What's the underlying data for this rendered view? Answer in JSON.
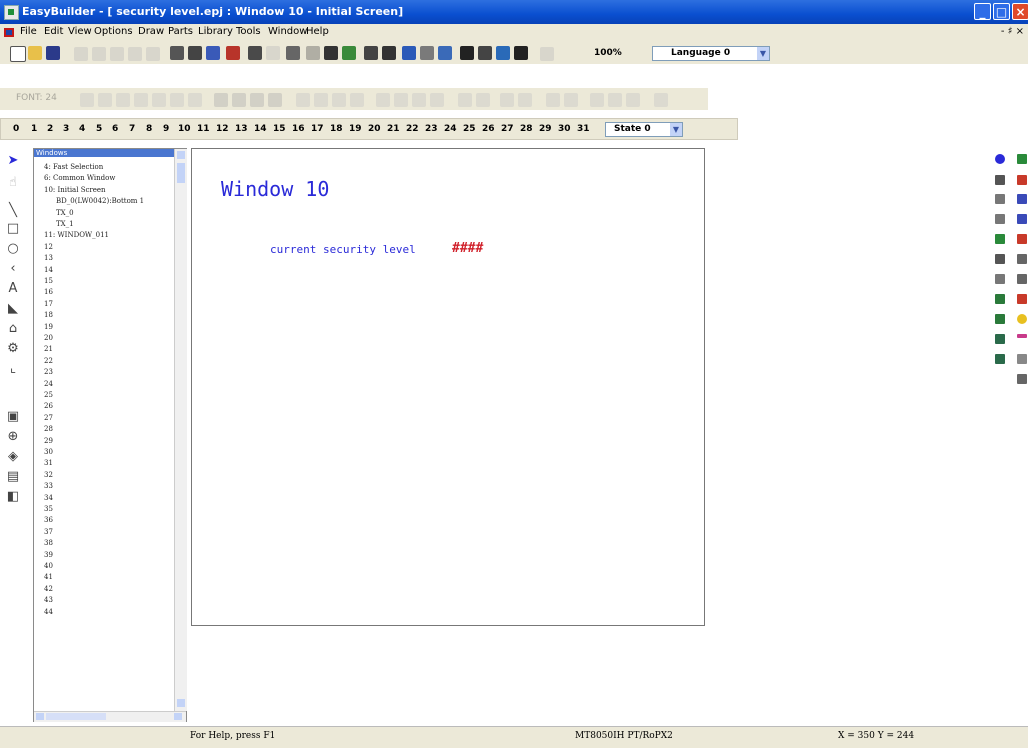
{
  "window": {
    "title": "EasyBuilder - [ security level.epj : Window 10 - Initial Screen]",
    "min": "_",
    "max": "□",
    "close": "×"
  },
  "menu": {
    "items": [
      "File",
      "Edit",
      "View",
      "Options",
      "Draw",
      "Parts",
      "Library",
      "Tools",
      "Window",
      "Help"
    ],
    "mdi_controls": "- ♯ ×"
  },
  "toolbar1": {
    "zoom": "100%",
    "language": "Language 0"
  },
  "toolbar2": {
    "font_label": "FONT: 24"
  },
  "toolbar3": {
    "states": [
      "0",
      "1",
      "2",
      "3",
      "4",
      "5",
      "6",
      "7",
      "8",
      "9",
      "10",
      "11",
      "12",
      "13",
      "14",
      "15",
      "16",
      "17",
      "18",
      "19",
      "20",
      "21",
      "22",
      "23",
      "24",
      "25",
      "26",
      "27",
      "28",
      "29",
      "30",
      "31"
    ],
    "state_select": "State 0"
  },
  "tree": {
    "header": "Windows",
    "items": [
      {
        "text": "4: Fast Selection",
        "indent": 1
      },
      {
        "text": "6: Common Window",
        "indent": 1
      },
      {
        "text": "10: Initial Screen",
        "indent": 1
      },
      {
        "text": "BD_0(LW0042):Bottom 1",
        "indent": 3
      },
      {
        "text": "TX_0",
        "indent": 3
      },
      {
        "text": "TX_1",
        "indent": 3
      },
      {
        "text": "11: WINDOW_011",
        "indent": 1
      },
      {
        "text": "12",
        "indent": 1
      },
      {
        "text": "13",
        "indent": 1
      },
      {
        "text": "14",
        "indent": 1
      },
      {
        "text": "15",
        "indent": 1
      },
      {
        "text": "16",
        "indent": 1
      },
      {
        "text": "17",
        "indent": 1
      },
      {
        "text": "18",
        "indent": 1
      },
      {
        "text": "19",
        "indent": 1
      },
      {
        "text": "20",
        "indent": 1
      },
      {
        "text": "21",
        "indent": 1
      },
      {
        "text": "22",
        "indent": 1
      },
      {
        "text": "23",
        "indent": 1
      },
      {
        "text": "24",
        "indent": 1
      },
      {
        "text": "25",
        "indent": 1
      },
      {
        "text": "26",
        "indent": 1
      },
      {
        "text": "27",
        "indent": 1
      },
      {
        "text": "28",
        "indent": 1
      },
      {
        "text": "29",
        "indent": 1
      },
      {
        "text": "30",
        "indent": 1
      },
      {
        "text": "31",
        "indent": 1
      },
      {
        "text": "32",
        "indent": 1
      },
      {
        "text": "33",
        "indent": 1
      },
      {
        "text": "34",
        "indent": 1
      },
      {
        "text": "35",
        "indent": 1
      },
      {
        "text": "36",
        "indent": 1
      },
      {
        "text": "37",
        "indent": 1
      },
      {
        "text": "38",
        "indent": 1
      },
      {
        "text": "39",
        "indent": 1
      },
      {
        "text": "40",
        "indent": 1
      },
      {
        "text": "41",
        "indent": 1
      },
      {
        "text": "42",
        "indent": 1
      },
      {
        "text": "43",
        "indent": 1
      },
      {
        "text": "44",
        "indent": 1
      }
    ]
  },
  "canvas": {
    "window_title": "Window 10",
    "security_label": "current security level",
    "security_value": "####"
  },
  "status": {
    "help": "For Help, press F1",
    "model": "MT8050IH PT/RoPX2",
    "coords": "X = 350  Y = 244"
  },
  "colors": {
    "title_bar": "#0a4fd0",
    "canvas_text": "#2a2ad8",
    "value_text": "#d0202a",
    "chrome": "#ece9d8"
  }
}
